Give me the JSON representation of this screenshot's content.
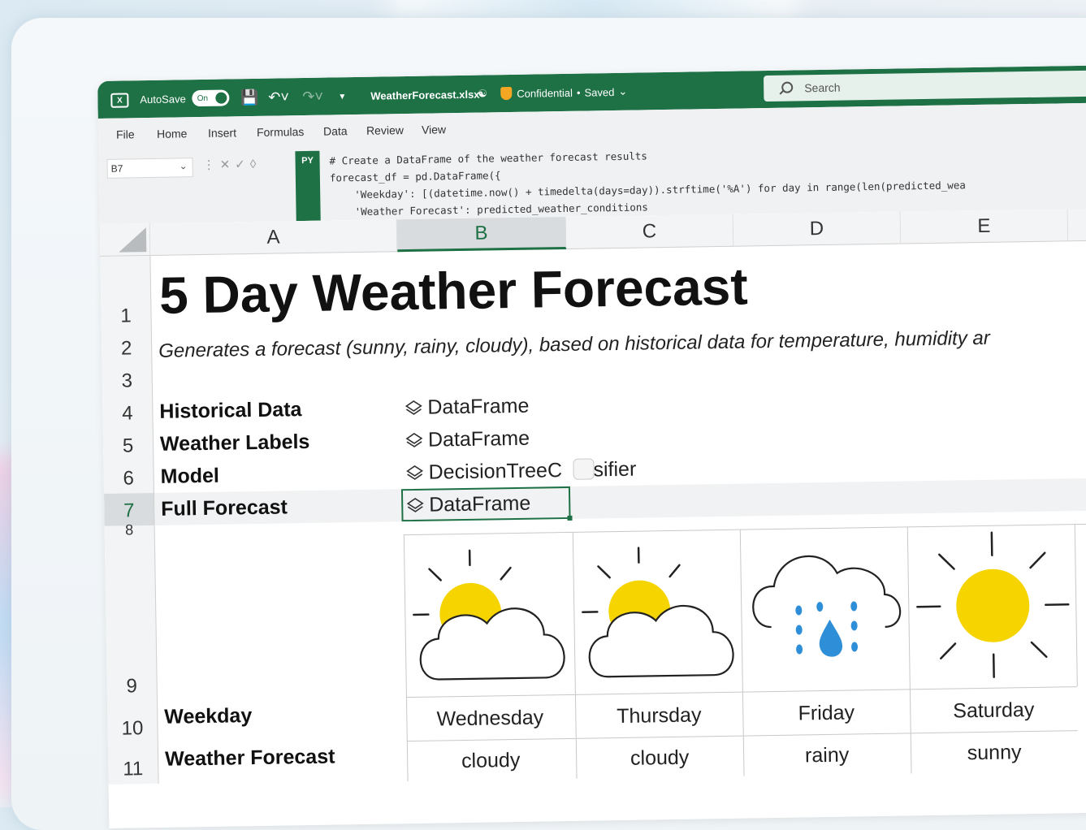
{
  "titlebar": {
    "autosave_label": "AutoSave",
    "autosave_state": "On",
    "filename": "WeatherForecast.xlsx",
    "sensitivity": "Confidential",
    "status": "Saved",
    "search_placeholder": "Search"
  },
  "menu": [
    "File",
    "Home",
    "Insert",
    "Formulas",
    "Data",
    "Review",
    "View"
  ],
  "formula_bar": {
    "name_box": "B7",
    "py_badge": "PY",
    "code_lines": [
      "# Create a DataFrame of the weather forecast results",
      "forecast_df = pd.DataFrame({",
      "    'Weekday': [(datetime.now() + timedelta(days=day)).strftime('%A') for day in range(len(predicted_wea",
      "    'Weather Forecast': predicted_weather_conditions"
    ]
  },
  "columns": [
    "A",
    "B",
    "C",
    "D",
    "E"
  ],
  "selected_column": "B",
  "rows": [
    "1",
    "2",
    "3",
    "4",
    "5",
    "6",
    "7",
    "8",
    "9",
    "10",
    "11"
  ],
  "sheet": {
    "title": "5 Day Weather Forecast",
    "subtitle": "Generates a forecast (sunny, rainy, cloudy), based on historical data for temperature, humidity ar",
    "items": [
      {
        "label": "Historical Data",
        "value": "DataFrame"
      },
      {
        "label": "Weather Labels",
        "value": "DataFrame"
      },
      {
        "label": "Model",
        "value": "DecisionTreeC",
        "value_tail": "ssifier"
      },
      {
        "label": "Full Forecast",
        "value": "DataFrame"
      }
    ],
    "weekday_label": "Weekday",
    "forecast_label": "Weather Forecast",
    "days": [
      {
        "day": "Wednesday",
        "forecast": "cloudy",
        "icon": "partly-cloudy-icon"
      },
      {
        "day": "Thursday",
        "forecast": "cloudy",
        "icon": "partly-cloudy-icon"
      },
      {
        "day": "Friday",
        "forecast": "rainy",
        "icon": "rain-cloud-icon"
      },
      {
        "day": "Saturday",
        "forecast": "sunny",
        "icon": "sun-icon"
      }
    ]
  },
  "colors": {
    "excel_green": "#1e7145",
    "sun_yellow": "#f5d400",
    "rain_blue": "#2f8ed8"
  }
}
